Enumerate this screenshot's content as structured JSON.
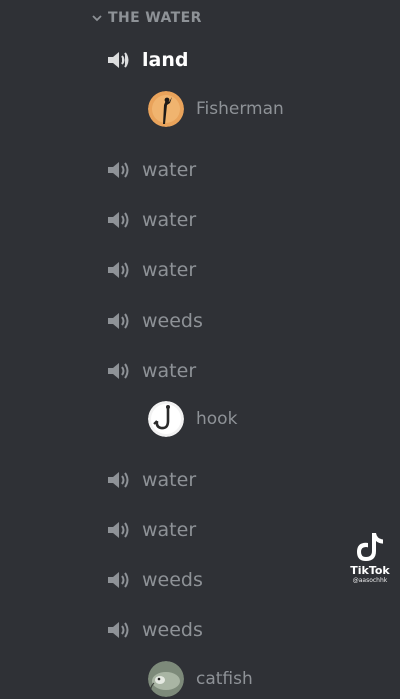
{
  "category": {
    "label": "THE WATER",
    "icon": "chevron-down-icon"
  },
  "channels": [
    {
      "label": "land",
      "icon": "speaker-icon",
      "active": true
    },
    {
      "label": "water",
      "icon": "speaker-icon"
    },
    {
      "label": "water",
      "icon": "speaker-icon"
    },
    {
      "label": "water",
      "icon": "speaker-icon"
    },
    {
      "label": "weeds",
      "icon": "speaker-icon"
    },
    {
      "label": "water",
      "icon": "speaker-icon"
    },
    {
      "label": "water",
      "icon": "speaker-icon"
    },
    {
      "label": "water",
      "icon": "speaker-icon"
    },
    {
      "label": "weeds",
      "icon": "speaker-icon"
    },
    {
      "label": "weeds",
      "icon": "speaker-icon"
    }
  ],
  "users": [
    {
      "label": "Fisherman",
      "icon": "fisherman-avatar"
    },
    {
      "label": "hook",
      "icon": "hook-avatar"
    },
    {
      "label": "catfish",
      "icon": "catfish-avatar"
    }
  ],
  "watermark": {
    "name": "TikTok",
    "handle": "@aasochhk"
  },
  "colors": {
    "background": "#2f3136",
    "muted_text": "#8e9297",
    "active_text": "#ffffff"
  }
}
